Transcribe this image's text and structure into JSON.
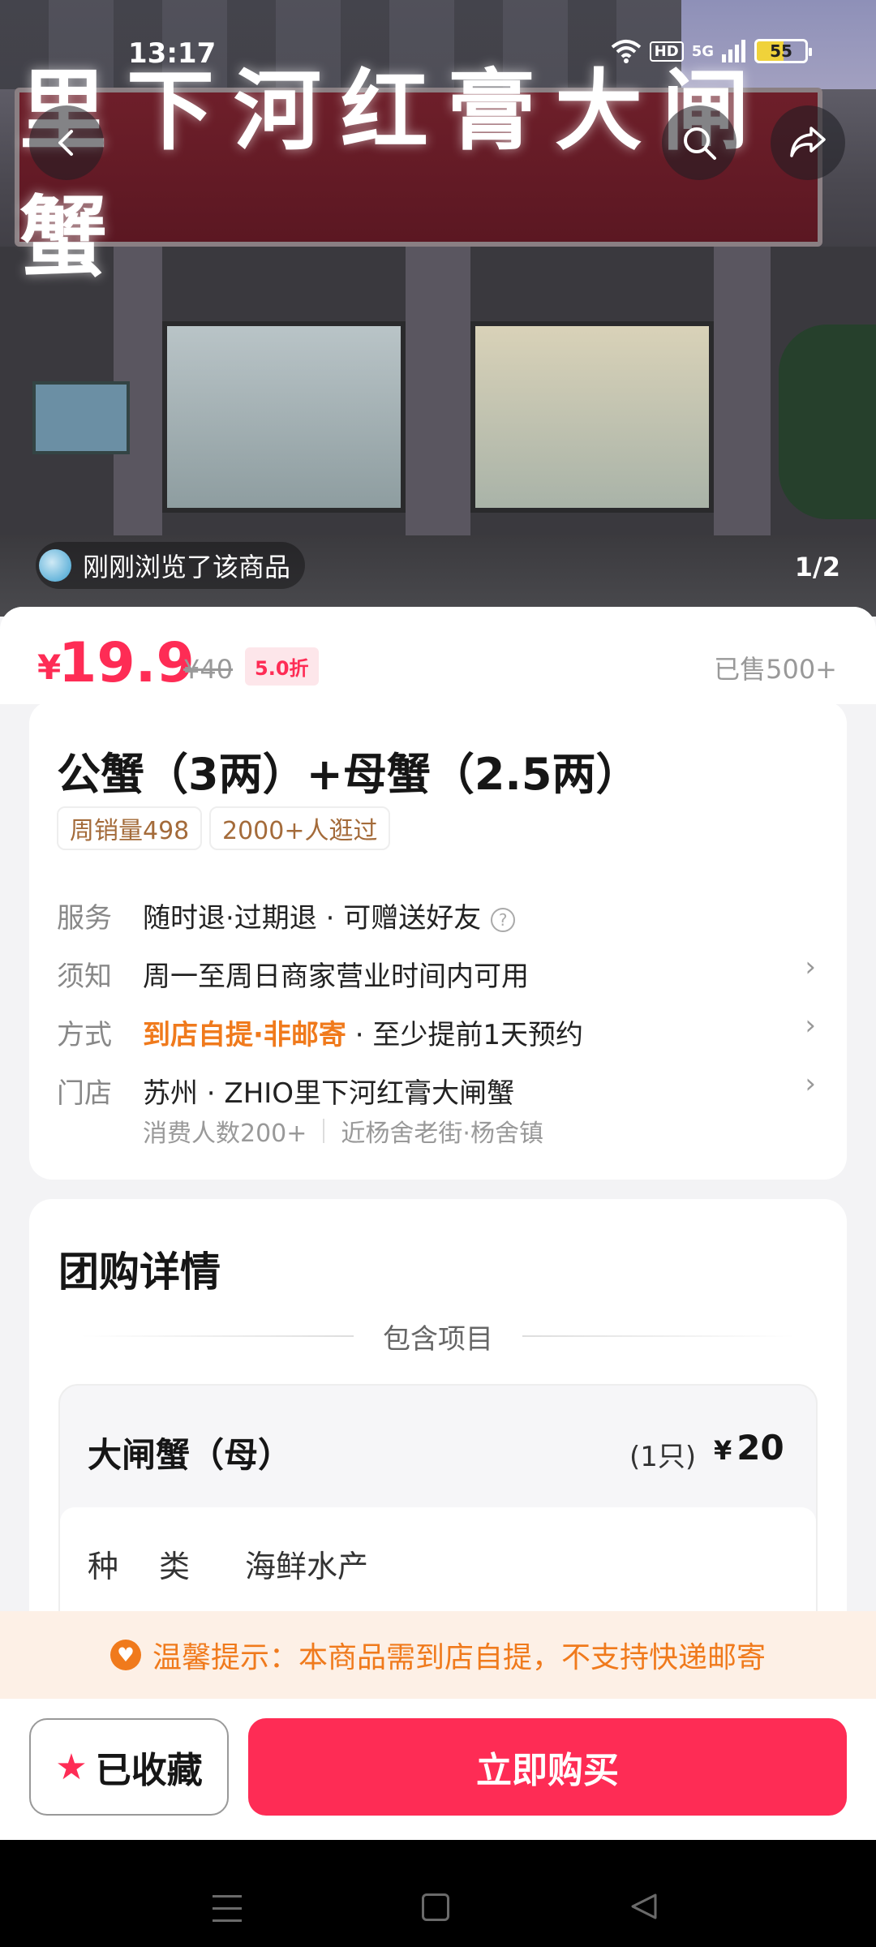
{
  "status_bar": {
    "time": "13:17",
    "hd": "HD",
    "network": "5G",
    "battery": "55"
  },
  "hero": {
    "sign_text": "里下河红膏大闸蟹",
    "viewed_text": "刚刚浏览了该商品",
    "pager": "1/2"
  },
  "price": {
    "currency": "¥",
    "value": "19.9",
    "original": "¥40",
    "discount": "5.0折",
    "sold": "已售500+"
  },
  "product": {
    "title": "公蟹（3两）+母蟹（2.5两）",
    "tags": [
      "周销量498",
      "2000+人逛过"
    ],
    "rows": [
      {
        "label": "服务",
        "value": "随时退·过期退 · 可赠送好友"
      },
      {
        "label": "须知",
        "value": "周一至周日商家营业时间内可用"
      },
      {
        "label": "方式",
        "highlight": "到店自提·非邮寄",
        "value": " · 至少提前1天预约"
      },
      {
        "label": "门店",
        "value": "苏州 · ZHIO里下河红膏大闸蟹"
      }
    ],
    "store_people": "消费人数200+",
    "store_near": "近杨舍老街·杨舍镇"
  },
  "details": {
    "title": "团购详情",
    "includes": "包含项目",
    "item_name": "大闸蟹（母）",
    "item_qty": "(1只)",
    "item_currency": "¥",
    "item_price": "20",
    "kind_label": "种类",
    "kind_value": "海鲜水产"
  },
  "tip": {
    "text": "温馨提示：本商品需到店自提，不支持快递邮寄"
  },
  "actions": {
    "fav_label": "已收藏",
    "buy_label": "立即购买"
  },
  "colors": {
    "accent": "#fe2c55",
    "orange": "#f07a1c"
  }
}
